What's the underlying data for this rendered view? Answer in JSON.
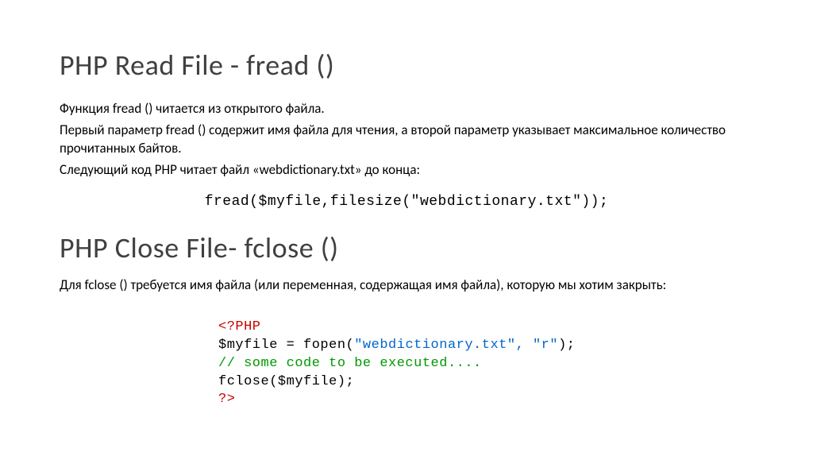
{
  "section1": {
    "heading": "PHP Read File - fread ()",
    "para1": "Функция fread () читается из открытого файла.",
    "para2": "Первый параметр fread () содержит имя файла для чтения, а второй параметр указывает максимальное количество прочитанных байтов.",
    "para3": "Следующий код PHP читает файл «webdictionary.txt» до конца:",
    "code": "fread($myfile,filesize(\"webdictionary.txt\"));"
  },
  "section2": {
    "heading": "PHP Close File- fclose ()",
    "para1": "Для fclose () требуется имя файла (или переменная, содержащая имя файла), которую мы хотим закрыть:",
    "code": {
      "line1": "<?PHP",
      "line2_pre": "$myfile = fopen(",
      "line2_str": "\"webdictionary.txt\", \"r\"",
      "line2_post": ");",
      "line3": "// some code to be executed....",
      "line4": "fclose($myfile);",
      "line5": "?>"
    }
  }
}
